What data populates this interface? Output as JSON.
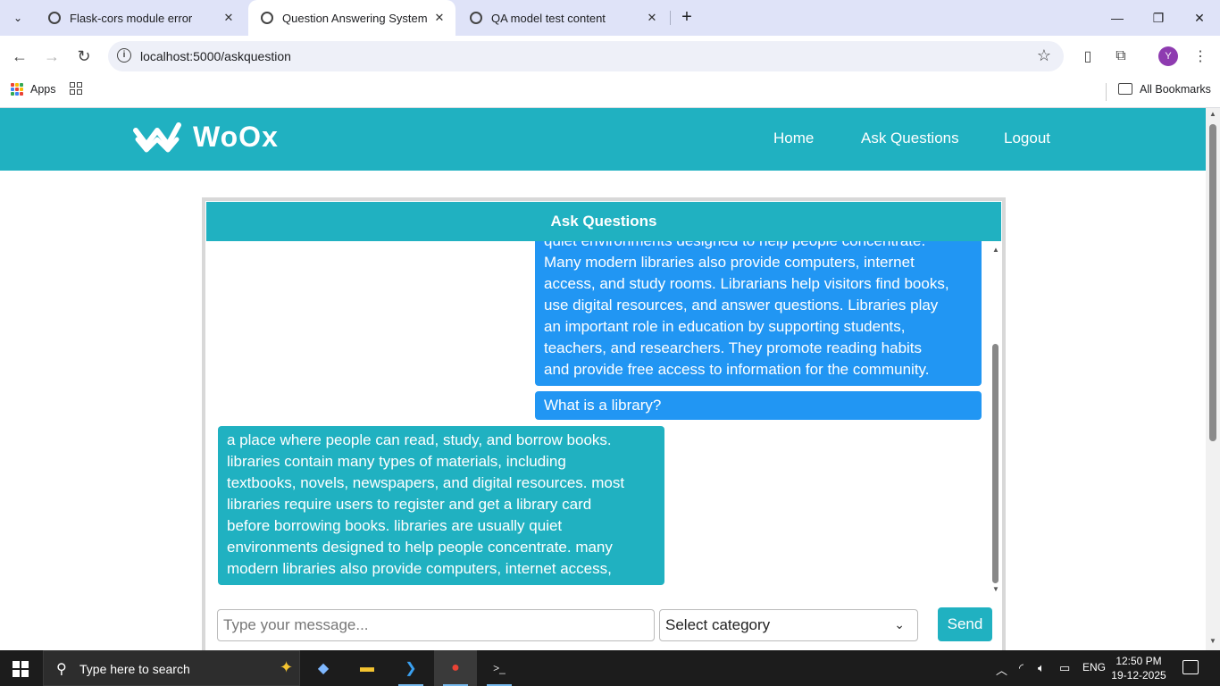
{
  "browser": {
    "tabs": [
      {
        "title": "Flask-cors module error",
        "close": "✕"
      },
      {
        "title": "Question Answering System",
        "close": "✕"
      },
      {
        "title": "QA model test content",
        "close": "✕"
      }
    ],
    "new_tab": "+",
    "address": "localhost:5000/askquestion",
    "bookmarks": {
      "apps_label": "Apps",
      "all_bookmarks": "All Bookmarks"
    },
    "profile_initial": "Y"
  },
  "site": {
    "brand": "WoOx",
    "nav": [
      "Home",
      "Ask Questions",
      "Logout"
    ],
    "accent_color": "#20b1c1",
    "user_bubble_color": "#2196f3"
  },
  "qa": {
    "header": "Ask Questions",
    "messages": [
      {
        "role": "user",
        "lines": [
          "quiet environments designed to help people concentrate.",
          "Many modern libraries also provide computers, internet",
          "access, and study rooms. Librarians help visitors find books,",
          "use digital resources, and answer questions. Libraries play",
          "an important role in education by supporting students,",
          "teachers, and researchers. They promote reading habits",
          "and provide free access to information for the community."
        ]
      },
      {
        "role": "user",
        "lines": [
          "What is a library?"
        ]
      },
      {
        "role": "bot",
        "lines": [
          "a place where people can read, study, and borrow books.",
          "libraries contain many types of materials, including",
          "textbooks, novels, newspapers, and digital resources. most",
          "libraries require users to register and get a library card",
          "before borrowing books. libraries are usually quiet",
          "environments designed to help people concentrate. many",
          "modern libraries also provide computers, internet access,"
        ]
      }
    ],
    "input_placeholder": "Type your message...",
    "category_selected": "Select category",
    "send_label": "Send"
  },
  "taskbar": {
    "search_placeholder": "Type here to search",
    "language": "ENG",
    "time": "12:50 PM",
    "date": "19-12-2025"
  }
}
